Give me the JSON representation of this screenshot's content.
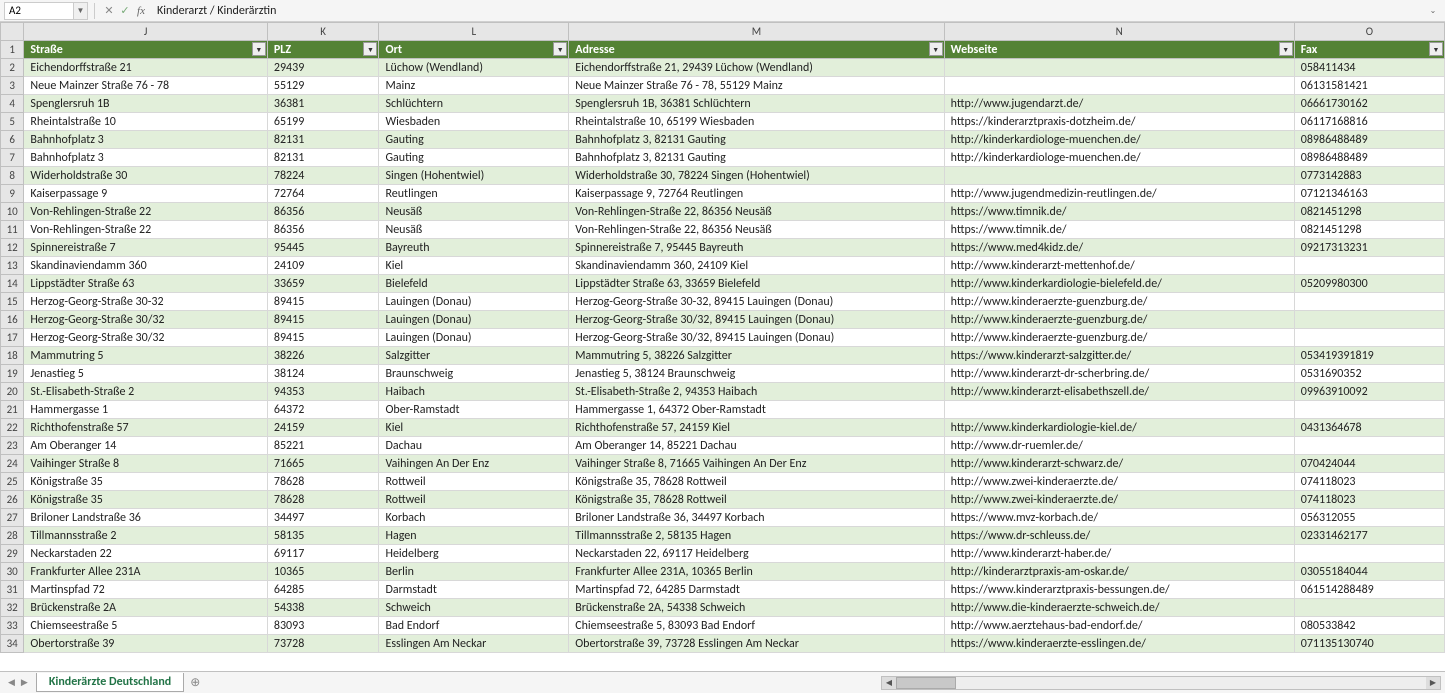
{
  "nameBox": "A2",
  "formula": "Kinderarzt / Kinderärztin",
  "columns": [
    "J",
    "K",
    "L",
    "M",
    "N",
    "O"
  ],
  "headers": {
    "J": "Straße",
    "K": "PLZ",
    "L": "Ort",
    "M": "Adresse",
    "N": "Webseite",
    "O": "Fax"
  },
  "sheetTab": "Kinderärzte Deutschland",
  "rows": [
    {
      "n": 2,
      "J": "Eichendorffstraße 21",
      "K": "29439",
      "L": "Lüchow (Wendland)",
      "M": "Eichendorffstraße 21, 29439 Lüchow (Wendland)",
      "N": "",
      "O": "058411434"
    },
    {
      "n": 3,
      "J": "Neue Mainzer Straße 76 - 78",
      "K": "55129",
      "L": "Mainz",
      "M": "Neue Mainzer Straße 76 - 78, 55129 Mainz",
      "N": "",
      "O": "06131581421"
    },
    {
      "n": 4,
      "J": "Spenglersruh 1B",
      "K": "36381",
      "L": "Schlüchtern",
      "M": "Spenglersruh 1B, 36381 Schlüchtern",
      "N": "http://www.jugendarzt.de/",
      "O": "06661730162"
    },
    {
      "n": 5,
      "J": "Rheintalstraße 10",
      "K": "65199",
      "L": "Wiesbaden",
      "M": "Rheintalstraße 10, 65199 Wiesbaden",
      "N": "https://kinderarztpraxis-dotzheim.de/",
      "O": "06117168816"
    },
    {
      "n": 6,
      "J": "Bahnhofplatz 3",
      "K": "82131",
      "L": "Gauting",
      "M": "Bahnhofplatz 3, 82131 Gauting",
      "N": "http://kinderkardiologe-muenchen.de/",
      "O": "08986488489"
    },
    {
      "n": 7,
      "J": "Bahnhofplatz 3",
      "K": "82131",
      "L": "Gauting",
      "M": "Bahnhofplatz 3, 82131 Gauting",
      "N": "http://kinderkardiologe-muenchen.de/",
      "O": "08986488489"
    },
    {
      "n": 8,
      "J": "Widerholdstraße 30",
      "K": "78224",
      "L": "Singen (Hohentwiel)",
      "M": "Widerholdstraße 30, 78224 Singen (Hohentwiel)",
      "N": "",
      "O": "0773142883"
    },
    {
      "n": 9,
      "J": "Kaiserpassage 9",
      "K": "72764",
      "L": "Reutlingen",
      "M": "Kaiserpassage 9, 72764 Reutlingen",
      "N": "http://www.jugendmedizin-reutlingen.de/",
      "O": "07121346163"
    },
    {
      "n": 10,
      "J": "Von-Rehlingen-Straße 22",
      "K": "86356",
      "L": "Neusäß",
      "M": "Von-Rehlingen-Straße 22, 86356 Neusäß",
      "N": "https://www.timnik.de/",
      "O": "0821451298"
    },
    {
      "n": 11,
      "J": "Von-Rehlingen-Straße 22",
      "K": "86356",
      "L": "Neusäß",
      "M": "Von-Rehlingen-Straße 22, 86356 Neusäß",
      "N": "https://www.timnik.de/",
      "O": "0821451298"
    },
    {
      "n": 12,
      "J": "Spinnereistraße 7",
      "K": "95445",
      "L": "Bayreuth",
      "M": "Spinnereistraße 7, 95445 Bayreuth",
      "N": "https://www.med4kidz.de/",
      "O": "09217313231"
    },
    {
      "n": 13,
      "J": "Skandinaviendamm 360",
      "K": "24109",
      "L": "Kiel",
      "M": "Skandinaviendamm 360, 24109 Kiel",
      "N": "http://www.kinderarzt-mettenhof.de/",
      "O": ""
    },
    {
      "n": 14,
      "J": "Lippstädter Straße 63",
      "K": "33659",
      "L": "Bielefeld",
      "M": "Lippstädter Straße 63, 33659 Bielefeld",
      "N": "http://www.kinderkardiologie-bielefeld.de/",
      "O": "05209980300"
    },
    {
      "n": 15,
      "J": "Herzog-Georg-Straße 30-32",
      "K": "89415",
      "L": "Lauingen (Donau)",
      "M": "Herzog-Georg-Straße 30-32, 89415 Lauingen (Donau)",
      "N": "http://www.kinderaerzte-guenzburg.de/",
      "O": ""
    },
    {
      "n": 16,
      "J": "Herzog-Georg-Straße 30/32",
      "K": "89415",
      "L": "Lauingen (Donau)",
      "M": "Herzog-Georg-Straße 30/32, 89415 Lauingen (Donau)",
      "N": "http://www.kinderaerzte-guenzburg.de/",
      "O": ""
    },
    {
      "n": 17,
      "J": "Herzog-Georg-Straße 30/32",
      "K": "89415",
      "L": "Lauingen (Donau)",
      "M": "Herzog-Georg-Straße 30/32, 89415 Lauingen (Donau)",
      "N": "http://www.kinderaerzte-guenzburg.de/",
      "O": ""
    },
    {
      "n": 18,
      "J": "Mammutring 5",
      "K": "38226",
      "L": "Salzgitter",
      "M": "Mammutring 5, 38226 Salzgitter",
      "N": "https://www.kinderarzt-salzgitter.de/",
      "O": "053419391819"
    },
    {
      "n": 19,
      "J": "Jenastieg 5",
      "K": "38124",
      "L": "Braunschweig",
      "M": "Jenastieg 5, 38124 Braunschweig",
      "N": "http://www.kinderarzt-dr-scherbring.de/",
      "O": "0531690352"
    },
    {
      "n": 20,
      "J": "St.-Elisabeth-Straße 2",
      "K": "94353",
      "L": "Haibach",
      "M": "St.-Elisabeth-Straße 2, 94353 Haibach",
      "N": "http://www.kinderarzt-elisabethszell.de/",
      "O": "09963910092"
    },
    {
      "n": 21,
      "J": "Hammergasse 1",
      "K": "64372",
      "L": "Ober-Ramstadt",
      "M": "Hammergasse 1, 64372 Ober-Ramstadt",
      "N": "",
      "O": ""
    },
    {
      "n": 22,
      "J": "Richthofenstraße 57",
      "K": "24159",
      "L": "Kiel",
      "M": "Richthofenstraße 57, 24159 Kiel",
      "N": "http://www.kinderkardiologie-kiel.de/",
      "O": "0431364678"
    },
    {
      "n": 23,
      "J": "Am Oberanger 14",
      "K": "85221",
      "L": "Dachau",
      "M": "Am Oberanger 14, 85221 Dachau",
      "N": "http://www.dr-ruemler.de/",
      "O": ""
    },
    {
      "n": 24,
      "J": "Vaihinger Straße 8",
      "K": "71665",
      "L": "Vaihingen An Der Enz",
      "M": "Vaihinger Straße 8, 71665 Vaihingen An Der Enz",
      "N": "http://www.kinderarzt-schwarz.de/",
      "O": "070424044"
    },
    {
      "n": 25,
      "J": "Königstraße 35",
      "K": "78628",
      "L": "Rottweil",
      "M": "Königstraße 35, 78628 Rottweil",
      "N": "http://www.zwei-kinderaerzte.de/",
      "O": "074118023"
    },
    {
      "n": 26,
      "J": "Königstraße 35",
      "K": "78628",
      "L": "Rottweil",
      "M": "Königstraße 35, 78628 Rottweil",
      "N": "http://www.zwei-kinderaerzte.de/",
      "O": "074118023"
    },
    {
      "n": 27,
      "J": "Briloner Landstraße 36",
      "K": "34497",
      "L": "Korbach",
      "M": "Briloner Landstraße 36, 34497 Korbach",
      "N": "https://www.mvz-korbach.de/",
      "O": "056312055"
    },
    {
      "n": 28,
      "J": "Tillmannsstraße 2",
      "K": "58135",
      "L": "Hagen",
      "M": "Tillmannsstraße 2, 58135 Hagen",
      "N": "https://www.dr-schleuss.de/",
      "O": "02331462177"
    },
    {
      "n": 29,
      "J": "Neckarstaden 22",
      "K": "69117",
      "L": "Heidelberg",
      "M": "Neckarstaden 22, 69117 Heidelberg",
      "N": "http://www.kinderarzt-haber.de/",
      "O": ""
    },
    {
      "n": 30,
      "J": "Frankfurter Allee 231A",
      "K": "10365",
      "L": "Berlin",
      "M": "Frankfurter Allee 231A, 10365 Berlin",
      "N": "http://kinderarztpraxis-am-oskar.de/",
      "O": "03055184044"
    },
    {
      "n": 31,
      "J": "Martinspfad 72",
      "K": "64285",
      "L": "Darmstadt",
      "M": "Martinspfad 72, 64285 Darmstadt",
      "N": "https://www.kinderarztpraxis-bessungen.de/",
      "O": "061514288489"
    },
    {
      "n": 32,
      "J": "Brückenstraße 2A",
      "K": "54338",
      "L": "Schweich",
      "M": "Brückenstraße 2A, 54338 Schweich",
      "N": "http://www.die-kinderaerzte-schweich.de/",
      "O": ""
    },
    {
      "n": 33,
      "J": "Chiemseestraße 5",
      "K": "83093",
      "L": "Bad Endorf",
      "M": "Chiemseestraße 5, 83093 Bad Endorf",
      "N": "http://www.aerztehaus-bad-endorf.de/",
      "O": "080533842"
    },
    {
      "n": 34,
      "J": "Obertorstraße 39",
      "K": "73728",
      "L": "Esslingen Am Neckar",
      "M": "Obertorstraße 39, 73728 Esslingen Am Neckar",
      "N": "https://www.kinderaerzte-esslingen.de/",
      "O": "071135130740"
    }
  ]
}
